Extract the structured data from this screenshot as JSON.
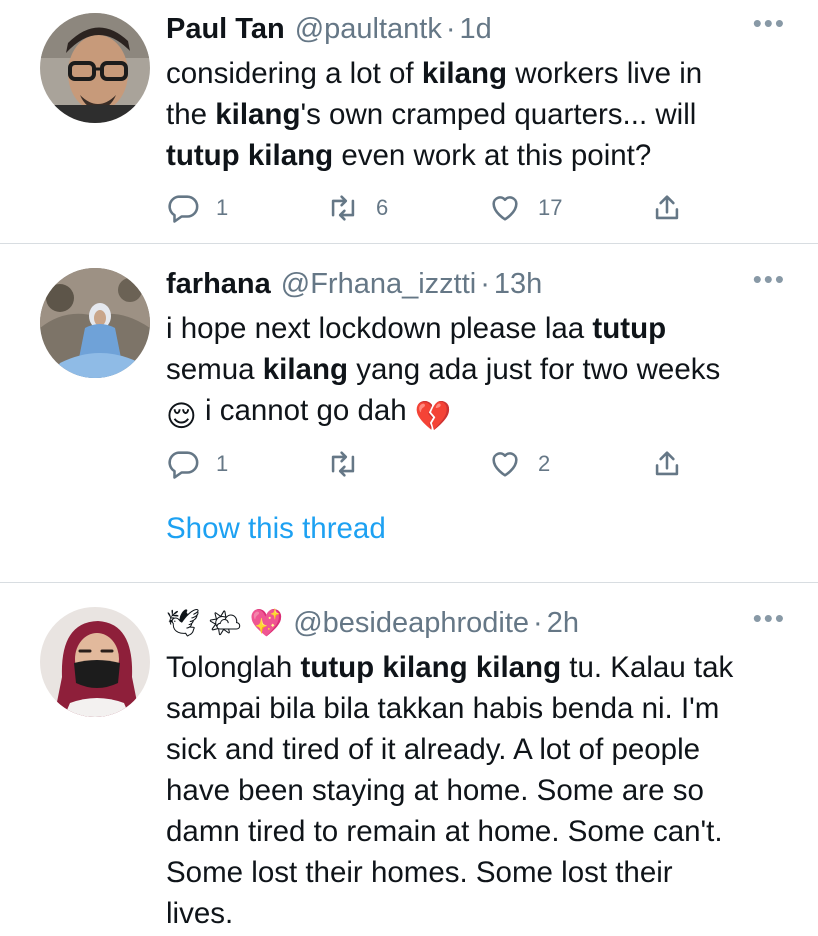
{
  "tweets": [
    {
      "name": "Paul Tan",
      "handle": "@paultantk",
      "sep": "·",
      "time": "1d",
      "more": "•••",
      "lines": [
        [
          {
            "t": "considering a lot of "
          },
          {
            "t": "kilang",
            "b": true
          },
          {
            "t": " workers live in"
          }
        ],
        [
          {
            "t": "the "
          },
          {
            "t": "kilang",
            "b": true
          },
          {
            "t": "'s own cramped quarters... will"
          }
        ],
        [
          {
            "t": "tutup kilang",
            "b": true
          },
          {
            "t": " even work at this point?"
          }
        ]
      ],
      "replies": "1",
      "retweets": "6",
      "likes": "17"
    },
    {
      "name": "farhana",
      "handle": "@Frhana_izztti",
      "sep": "·",
      "time": "13h",
      "more": "•••",
      "lines": [
        [
          {
            "t": "i hope next lockdown please laa "
          },
          {
            "t": "tutup",
            "b": true
          }
        ],
        [
          {
            "t": "semua "
          },
          {
            "t": "kilang",
            "b": true
          },
          {
            "t": " yang ada just for two weeks"
          }
        ],
        [
          {
            "t": "😌",
            "emoji": true
          },
          {
            "t": " i cannot go dah "
          },
          {
            "t": "💔",
            "emoji": true
          }
        ]
      ],
      "replies": "1",
      "retweets": "",
      "likes": "2",
      "show_thread": "Show this thread"
    },
    {
      "name_emojis": "🕊 🌤 💖",
      "handle": "@besideaphrodite",
      "sep": "·",
      "time": "2h",
      "more": "•••",
      "lines": [
        [
          {
            "t": "Tolonglah "
          },
          {
            "t": "tutup kilang kilang",
            "b": true
          },
          {
            "t": " tu. Kalau tak"
          }
        ],
        [
          {
            "t": "sampai bila bila takkan habis benda ni. I'm"
          }
        ],
        [
          {
            "t": "sick and tired of it already. A lot of people"
          }
        ],
        [
          {
            "t": "have been staying at home. Some are so"
          }
        ],
        [
          {
            "t": "damn tired to remain at home. Some can't."
          }
        ],
        [
          {
            "t": "Some lost their homes. Some lost their"
          }
        ],
        [
          {
            "t": "lives."
          }
        ]
      ]
    }
  ],
  "colors": {
    "text": "#0f1419",
    "secondary": "#657786",
    "link": "#1da1f2",
    "divider": "#d8dde1"
  },
  "icons": [
    "reply-icon",
    "retweet-icon",
    "like-icon",
    "share-icon",
    "more-icon"
  ]
}
